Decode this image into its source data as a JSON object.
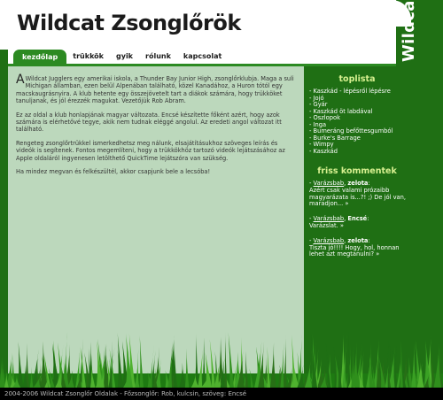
{
  "site": {
    "title": "Wildcat Zsonglőrök",
    "vertical_title": "Wildcat"
  },
  "nav": {
    "tabs": [
      "kezdőlap",
      "trükkök",
      "gyik",
      "rólunk",
      "kapcsolat"
    ]
  },
  "article": {
    "dropcap": "A",
    "paragraphs": [
      " Wildcat Jugglers egy amerikai iskola, a Thunder Bay Junior High, zsonglőrklubja. Maga a suli Michigan államban, ezen belül Alpenában található, közel Kanadához, a Huron tótól egy macskaugrásnyira. A klub hetente egy összejövetelt tart a diákok számára, hogy trükköket tanuljanak, és jól érezzék magukat. Vezetőjük Rob Abram.",
      "Ez az oldal a klub honlapjának magyar változata. Encsé készítette főként azért, hogy azok számára is elérhetővé tegye, akik nem tudnak eléggé angolul. Az eredeti angol változat itt található.",
      "Rengeteg zsonglőrtrükkel ismerkedhetsz meg nálunk, elsajátításukhoz szöveges leírás és videók is segítenek. Fontos megemlíteni, hogy a trükkökhöz tartozó videók lejátszásához az Apple oldaláról ingyenesen letölthető QuickTime lejátszóra van szükség.",
      "Ha mindez megvan és felkészültél, akkor csapjunk bele a lecsóba!"
    ]
  },
  "sidebar": {
    "toplist_title": "toplista",
    "toplist": [
      "- Kaszkád - lépésről lépésre",
      "- Jojó",
      "- Gyár",
      "- Kaszkád öt labdával",
      "- Oszlopok",
      "- Inga",
      "- Bumeráng befőttesgumból",
      "- Burke's Barrage",
      "- Wimpy",
      "- Kaszkád"
    ],
    "comments_title": "friss kommentek",
    "comments": [
      {
        "prefix": "- ",
        "link": "Varázsbab",
        "sep": ", ",
        "author": "zelota",
        "colon": ":",
        "text": "Azért csak valami prózaibb magyarázata is...?! ;) De jól van, maradjon...",
        "more": " »"
      },
      {
        "prefix": "- ",
        "link": "Varázsbab",
        "sep": ", ",
        "author": "Encsé",
        "colon": ":",
        "text": "Varázslat.",
        "more": " »"
      },
      {
        "prefix": "- ",
        "link": "Varázsbab",
        "sep": ", ",
        "author": "zelota",
        "colon": ":",
        "text": "Tiszta jó!!!! Hogy, hol, honnan lehet azt megtanulni?",
        "more": " »"
      }
    ]
  },
  "footer": {
    "text": "2004-2006 Wildcat Zsonglőr Oldalak - Főzsonglőr: Rob, kulcsin, szöveg: Encsé"
  },
  "colors": {
    "green": "#1f6f14",
    "tab_active": "#2c8a22",
    "content_bg": "#bcd8bc",
    "heading": "#d7f090"
  }
}
